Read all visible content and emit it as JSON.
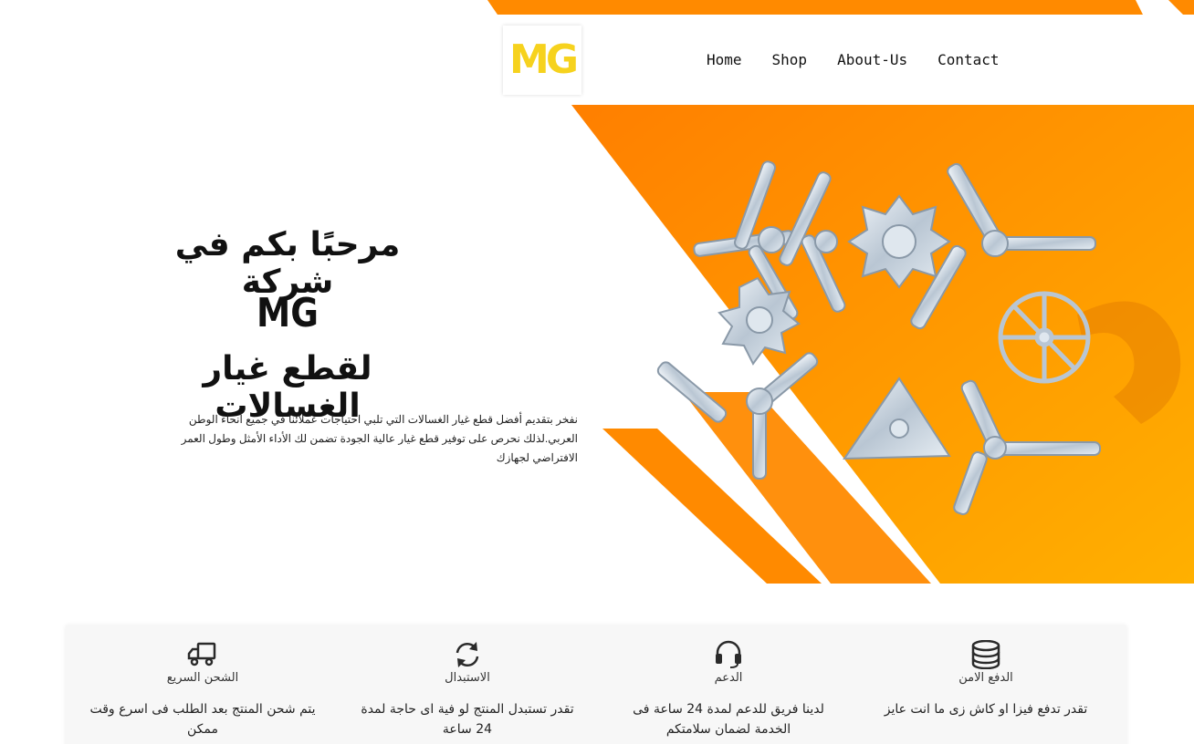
{
  "colors": {
    "orange": "#ff8a00",
    "orange_light": "#ffae1a",
    "logo_yellow": "#f6d21e",
    "icon_dark": "#2a2a2a"
  },
  "header": {
    "logo_text": "MG",
    "nav": [
      {
        "label": "Home"
      },
      {
        "label": "Shop"
      },
      {
        "label": "About-Us"
      },
      {
        "label": "Contact"
      }
    ]
  },
  "hero": {
    "title_line1": "مرحبًا بكم في شركة",
    "title_line2": "MG",
    "title_line3": "لقطع غيار الغسالات",
    "description": "نفخر بتقديم أفضل قطع غيار الغسالات التي تلبي احتياجات عملائنا في جميع أنحاء الوطن العربي.لذلك نحرص على توفير قطع غيار عالية الجودة تضمن لك الأداء الأمثل وطول العمر الافتراضي لجهازك"
  },
  "features": [
    {
      "icon": "database-icon",
      "title": "الدفع الامن",
      "desc": "تقدر تدفع فيزا او كاش زى ما انت عايز"
    },
    {
      "icon": "headset-icon",
      "title": "الدعم",
      "desc": "لدينا فريق للدعم لمدة 24 ساعة فى الخدمة لضمان سلامتكم"
    },
    {
      "icon": "refresh-icon",
      "title": "الاستبدال",
      "desc": "تقدر تستبدل المنتج لو فية اى حاجة لمدة 24 ساعة"
    },
    {
      "icon": "truck-icon",
      "title": "الشحن السريع",
      "desc": "يتم شحن المنتج بعد الطلب فى اسرع وقت ممكن"
    }
  ]
}
